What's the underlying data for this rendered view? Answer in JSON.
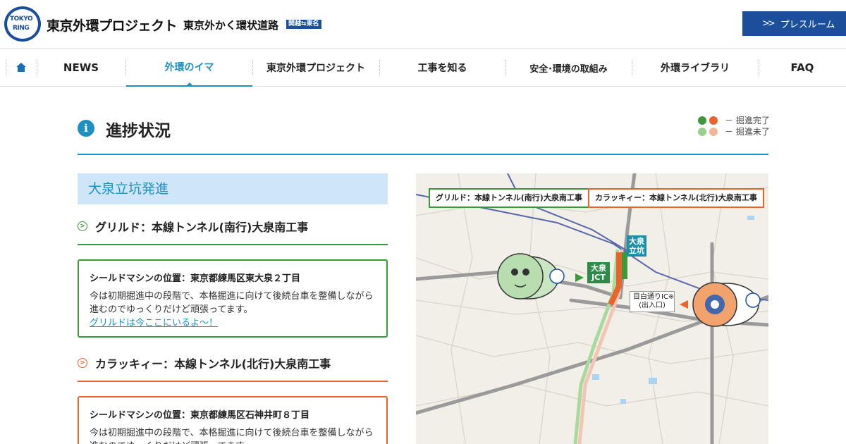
{
  "header": {
    "logo_line1": "TOKYO",
    "logo_line2": "RING",
    "site_title": "東京外環プロジェクト",
    "site_subtitle": "東京外かく環状道路",
    "badge": "関越⇆東名",
    "press_room": "プレスルーム"
  },
  "nav": {
    "items": [
      {
        "label": "NEWS"
      },
      {
        "label": "外環のイマ"
      },
      {
        "label": "東京外環プロジェクト"
      },
      {
        "label": "工事を知る"
      },
      {
        "label": "安全･環境の取組み"
      },
      {
        "label": "外環ライブラリ"
      },
      {
        "label": "FAQ"
      }
    ]
  },
  "section": {
    "title": "進捗状況",
    "legend": [
      {
        "text": "－  掘進完了",
        "colors": [
          "#3a9a3a",
          "#e9642b"
        ]
      },
      {
        "text": "－  掘進未了",
        "colors": [
          "#98d28a",
          "#f4b49a"
        ]
      }
    ]
  },
  "subsection": {
    "title": "大泉立坑発進"
  },
  "machines": [
    {
      "heading": "グリルド：本線トンネル(南行)大泉南工事",
      "color": "#3a9a3a",
      "location": "シールドマシンの位置：東京都練馬区東大泉２丁目",
      "description": "今は初期掘進中の段階で、本格掘進に向けて後続台車を整備しながら進むのでゆっくりだけど頑張ってます。",
      "link": "グリルドは今ここにいるよ～！"
    },
    {
      "heading": "カラッキィー：本線トンネル(北行)大泉南工事",
      "color": "#e9642b",
      "location": "シールドマシンの位置：東京都練馬区石神井町８丁目",
      "description": "今は初期掘進中の段階で、本格掘進に向けて後続台車を整備しながら進むのでゆっくりだけど頑張ってます。"
    }
  ],
  "map": {
    "label_green": "グリルド：本線トンネル(南行)大泉南工事",
    "label_orange": "カラッキィー：本線トンネル(北行)大泉南工事",
    "shaft": "大泉\n立坑",
    "jct": "大泉\nJCT",
    "ic": "目白通りIC※\n(出入口)"
  }
}
